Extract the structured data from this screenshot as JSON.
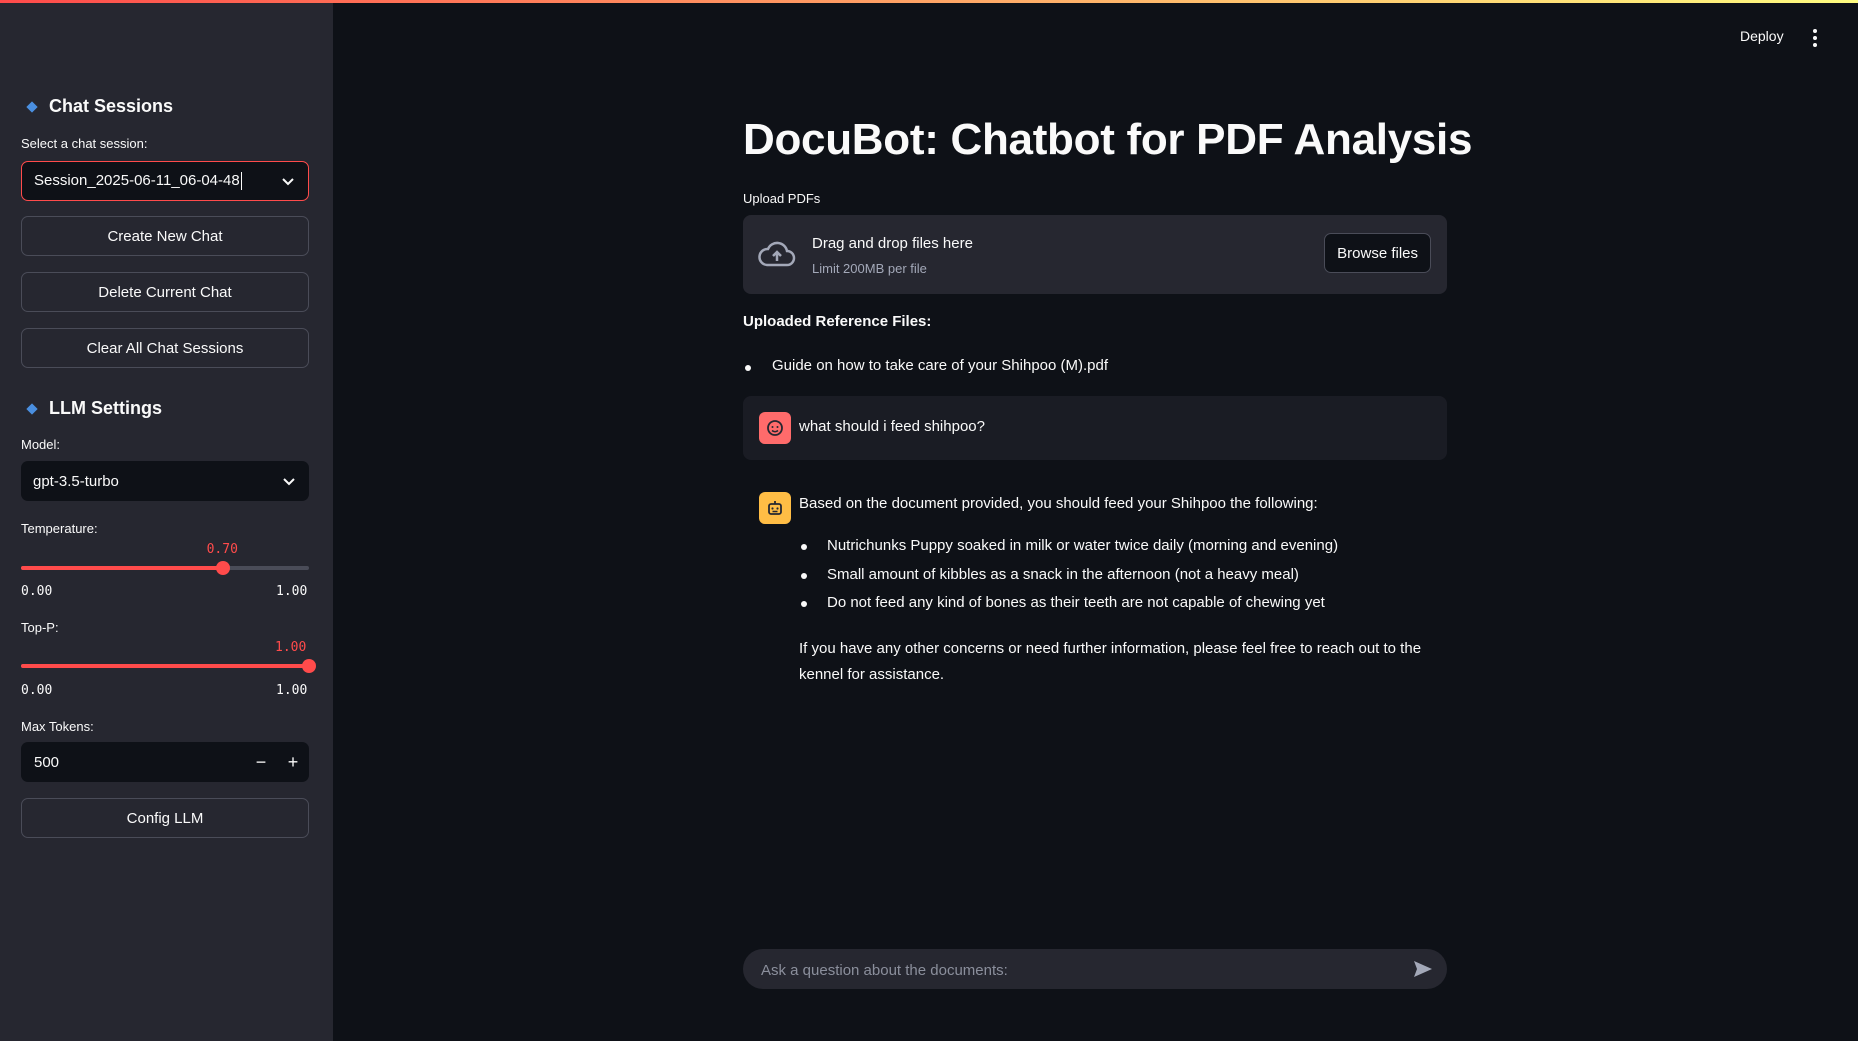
{
  "app": {
    "deploy_label": "Deploy",
    "title": "DocuBot: Chatbot for PDF Analysis"
  },
  "sidebar": {
    "chat_sessions": {
      "title": "Chat Sessions",
      "select_label": "Select a chat session:",
      "selected_session": "Session_2025-06-11_06-04-48",
      "create_button": "Create New Chat",
      "delete_button": "Delete Current Chat",
      "clear_button": "Clear All Chat Sessions"
    },
    "llm_settings": {
      "title": "LLM Settings",
      "model_label": "Model:",
      "model_value": "gpt-3.5-turbo",
      "temperature": {
        "label": "Temperature:",
        "value": 0.7,
        "display": "0.70",
        "min": "0.00",
        "max": "1.00"
      },
      "top_p": {
        "label": "Top-P:",
        "value": 1.0,
        "display": "1.00",
        "min": "0.00",
        "max": "1.00"
      },
      "max_tokens": {
        "label": "Max Tokens:",
        "value": "500",
        "minus": "−",
        "plus": "+"
      },
      "config_button": "Config LLM"
    }
  },
  "upload": {
    "label": "Upload PDFs",
    "drop_text": "Drag and drop files here",
    "limit_text": "Limit 200MB per file",
    "browse_button": "Browse files"
  },
  "references": {
    "title": "Uploaded Reference Files:",
    "files": [
      "Guide on how to take care of your Shihpoo (M).pdf"
    ]
  },
  "chat": {
    "user_message": "what should i feed shihpoo?",
    "assistant": {
      "intro": "Based on the document provided, you should feed your Shihpoo the following:",
      "items": [
        "Nutrichunks Puppy soaked in milk or water twice daily (morning and evening)",
        "Small amount of kibbles as a snack in the afternoon (not a heavy meal)",
        "Do not feed any kind of bones as their teeth are not capable of chewing yet"
      ],
      "closing": "If you have any other concerns or need further information, please feel free to reach out to the kennel for assistance."
    },
    "input_placeholder": "Ask a question about the documents:"
  },
  "colors": {
    "accent": "#ff4b4b",
    "user_avatar": "#ff6b6b",
    "bot_avatar": "#ffbd45",
    "sidebar_bg": "#262730",
    "main_bg": "#0e1117"
  },
  "icons": [
    "chevron-down-icon",
    "upload-cloud-icon",
    "user-avatar-icon",
    "bot-avatar-icon",
    "send-icon",
    "kebab-menu-icon"
  ]
}
